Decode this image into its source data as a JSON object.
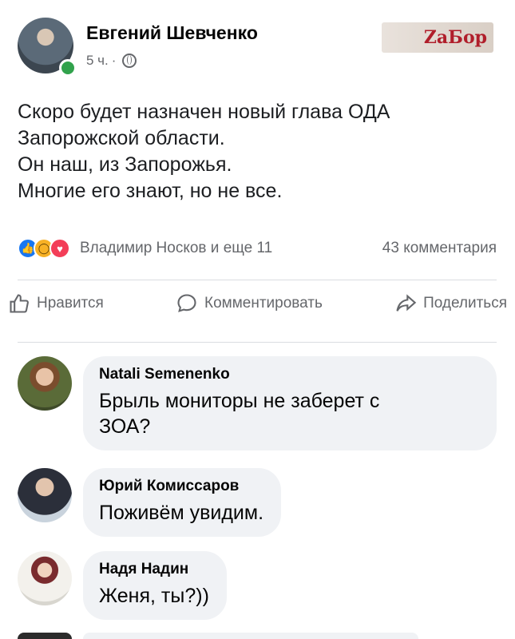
{
  "post": {
    "author": "Евгений Шевченко",
    "time": "5 ч.",
    "separator": "·",
    "globe_icon": "globe-icon",
    "text_lines": [
      "Скоро будет назначен новый глава ОДА",
      "Запорожской области.",
      "Он наш, из Запорожья.",
      "Многие его знают, но не все."
    ]
  },
  "watermark": {
    "text": "ZaБор"
  },
  "reactions": {
    "icons": [
      "like-icon",
      "wow-icon",
      "love-icon"
    ],
    "names": "Владимир Носков и еще 11",
    "comments_count": "43 комментария"
  },
  "actions": {
    "like": "Нравится",
    "comment": "Комментировать",
    "share": "Поделиться"
  },
  "comments": [
    {
      "name": "Natali Semenenko",
      "lines": [
        "Брыль мониторы не заберет с",
        "ЗОА?"
      ]
    },
    {
      "name": "Юрий Комиссаров",
      "lines": [
        "Поживём увидим."
      ]
    },
    {
      "name": "Надя Надин",
      "lines": [
        "Женя, ты?))"
      ]
    }
  ],
  "colors": {
    "online": "#31a24c",
    "like": "#1877f2",
    "bubble": "#f0f2f5",
    "secondary_text": "#65676b"
  }
}
